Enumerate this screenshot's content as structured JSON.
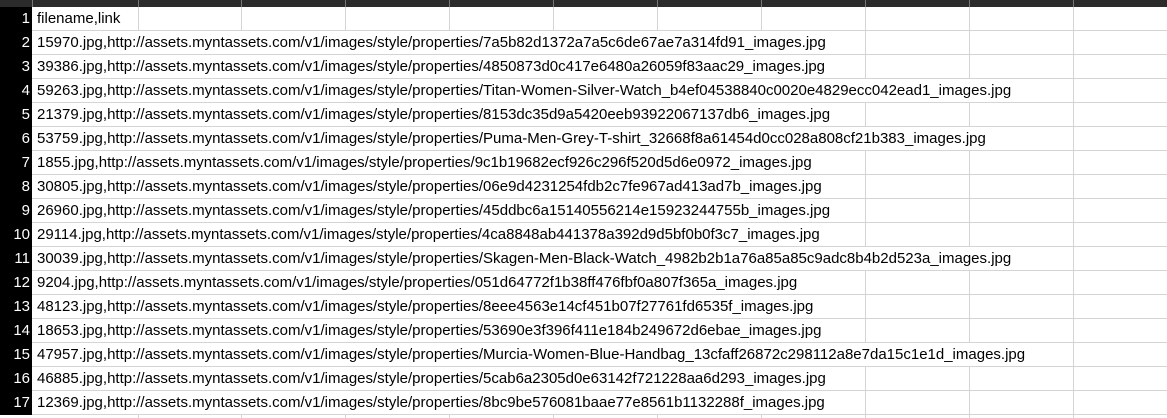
{
  "row_numbers": [
    "1",
    "2",
    "3",
    "4",
    "5",
    "6",
    "7",
    "8",
    "9",
    "10",
    "11",
    "12",
    "13",
    "14",
    "15",
    "16",
    "17"
  ],
  "rows": [
    "filename,link",
    "15970.jpg,http://assets.myntassets.com/v1/images/style/properties/7a5b82d1372a7a5c6de67ae7a314fd91_images.jpg",
    "39386.jpg,http://assets.myntassets.com/v1/images/style/properties/4850873d0c417e6480a26059f83aac29_images.jpg",
    "59263.jpg,http://assets.myntassets.com/v1/images/style/properties/Titan-Women-Silver-Watch_b4ef04538840c0020e4829ecc042ead1_images.jpg",
    "21379.jpg,http://assets.myntassets.com/v1/images/style/properties/8153dc35d9a5420eeb93922067137db6_images.jpg",
    "53759.jpg,http://assets.myntassets.com/v1/images/style/properties/Puma-Men-Grey-T-shirt_32668f8a61454d0cc028a808cf21b383_images.jpg",
    "1855.jpg,http://assets.myntassets.com/v1/images/style/properties/9c1b19682ecf926c296f520d5d6e0972_images.jpg",
    "30805.jpg,http://assets.myntassets.com/v1/images/style/properties/06e9d4231254fdb2c7fe967ad413ad7b_images.jpg",
    "26960.jpg,http://assets.myntassets.com/v1/images/style/properties/45ddbc6a15140556214e15923244755b_images.jpg",
    "29114.jpg,http://assets.myntassets.com/v1/images/style/properties/4ca8848ab441378a392d9d5bf0b0f3c7_images.jpg",
    "30039.jpg,http://assets.myntassets.com/v1/images/style/properties/Skagen-Men-Black-Watch_4982b2b1a76a85a85c9adc8b4b2d523a_images.jpg",
    "9204.jpg,http://assets.myntassets.com/v1/images/style/properties/051d64772f1b38ff476fbf0a807f365a_images.jpg",
    "48123.jpg,http://assets.myntassets.com/v1/images/style/properties/8eee4563e14cf451b07f27761fd6535f_images.jpg",
    "18653.jpg,http://assets.myntassets.com/v1/images/style/properties/53690e3f396f411e184b249672d6ebae_images.jpg",
    "47957.jpg,http://assets.myntassets.com/v1/images/style/properties/Murcia-Women-Blue-Handbag_13cfaff26872c298112a8e7da15c1e1d_images.jpg",
    "46885.jpg,http://assets.myntassets.com/v1/images/style/properties/5cab6a2305d0e63142f721228aa6d293_images.jpg",
    "12369.jpg,http://assets.myntassets.com/v1/images/style/properties/8bc9be576081baae77e8561b1132288f_images.jpg"
  ]
}
